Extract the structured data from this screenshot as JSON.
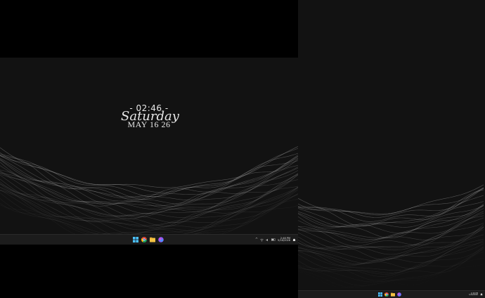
{
  "desktop_widget": {
    "time": "- 02:46 -",
    "day": "Saturday",
    "date": "MAY 16 26"
  },
  "taskbar": {
    "icons": [
      "windows-start-icon",
      "chrome-icon",
      "file-explorer-icon",
      "copilot-icon"
    ],
    "tray_icons": [
      "chevron-up-icon",
      "wifi-icon",
      "volume-icon",
      "battery-icon",
      "bell-icon"
    ],
    "time": "2:46 PM",
    "date": "5/16/2026"
  },
  "colors": {
    "desktop_background": "#121212",
    "taskbar_background": "#1c1c1c",
    "wave": "#ffffff"
  }
}
